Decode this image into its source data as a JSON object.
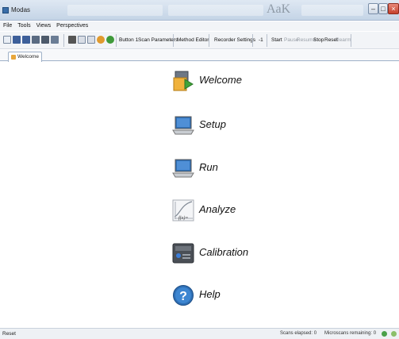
{
  "window": {
    "title": "Modas",
    "ghost_text": "AaK"
  },
  "menu": [
    "File",
    "Tools",
    "Views",
    "Perspectives"
  ],
  "toolbar": {
    "button1_label": "Button 1",
    "scan_parameters_label": "Scan Parameters",
    "method_editor_label": "Method Editor",
    "recorder_settings_label": "Recorder Settings",
    "counter_value": "-1",
    "start_label": "Start",
    "pause_label": "Pause",
    "resume_label": "Resume",
    "stop_label": "Stop",
    "reset_label": "Reset",
    "rearm_label": "Rearm"
  },
  "tabs": [
    {
      "label": "Welcome"
    }
  ],
  "launcher": [
    {
      "label": "Welcome",
      "icon": "welcome-icon"
    },
    {
      "label": "Setup",
      "icon": "laptop-icon"
    },
    {
      "label": "Run",
      "icon": "laptop-icon"
    },
    {
      "label": "Analyze",
      "icon": "function-plot-icon"
    },
    {
      "label": "Calibration",
      "icon": "device-panel-icon"
    },
    {
      "label": "Help",
      "icon": "help-icon"
    }
  ],
  "status": {
    "message": "Reset",
    "scans_elapsed": "Scans elapsed: 0",
    "microscans_remaining": "Microscans remaining: 0"
  },
  "colors": {
    "accent": "#2f6fb5",
    "titlebar": "#cfdceb",
    "close": "#c5402c"
  }
}
